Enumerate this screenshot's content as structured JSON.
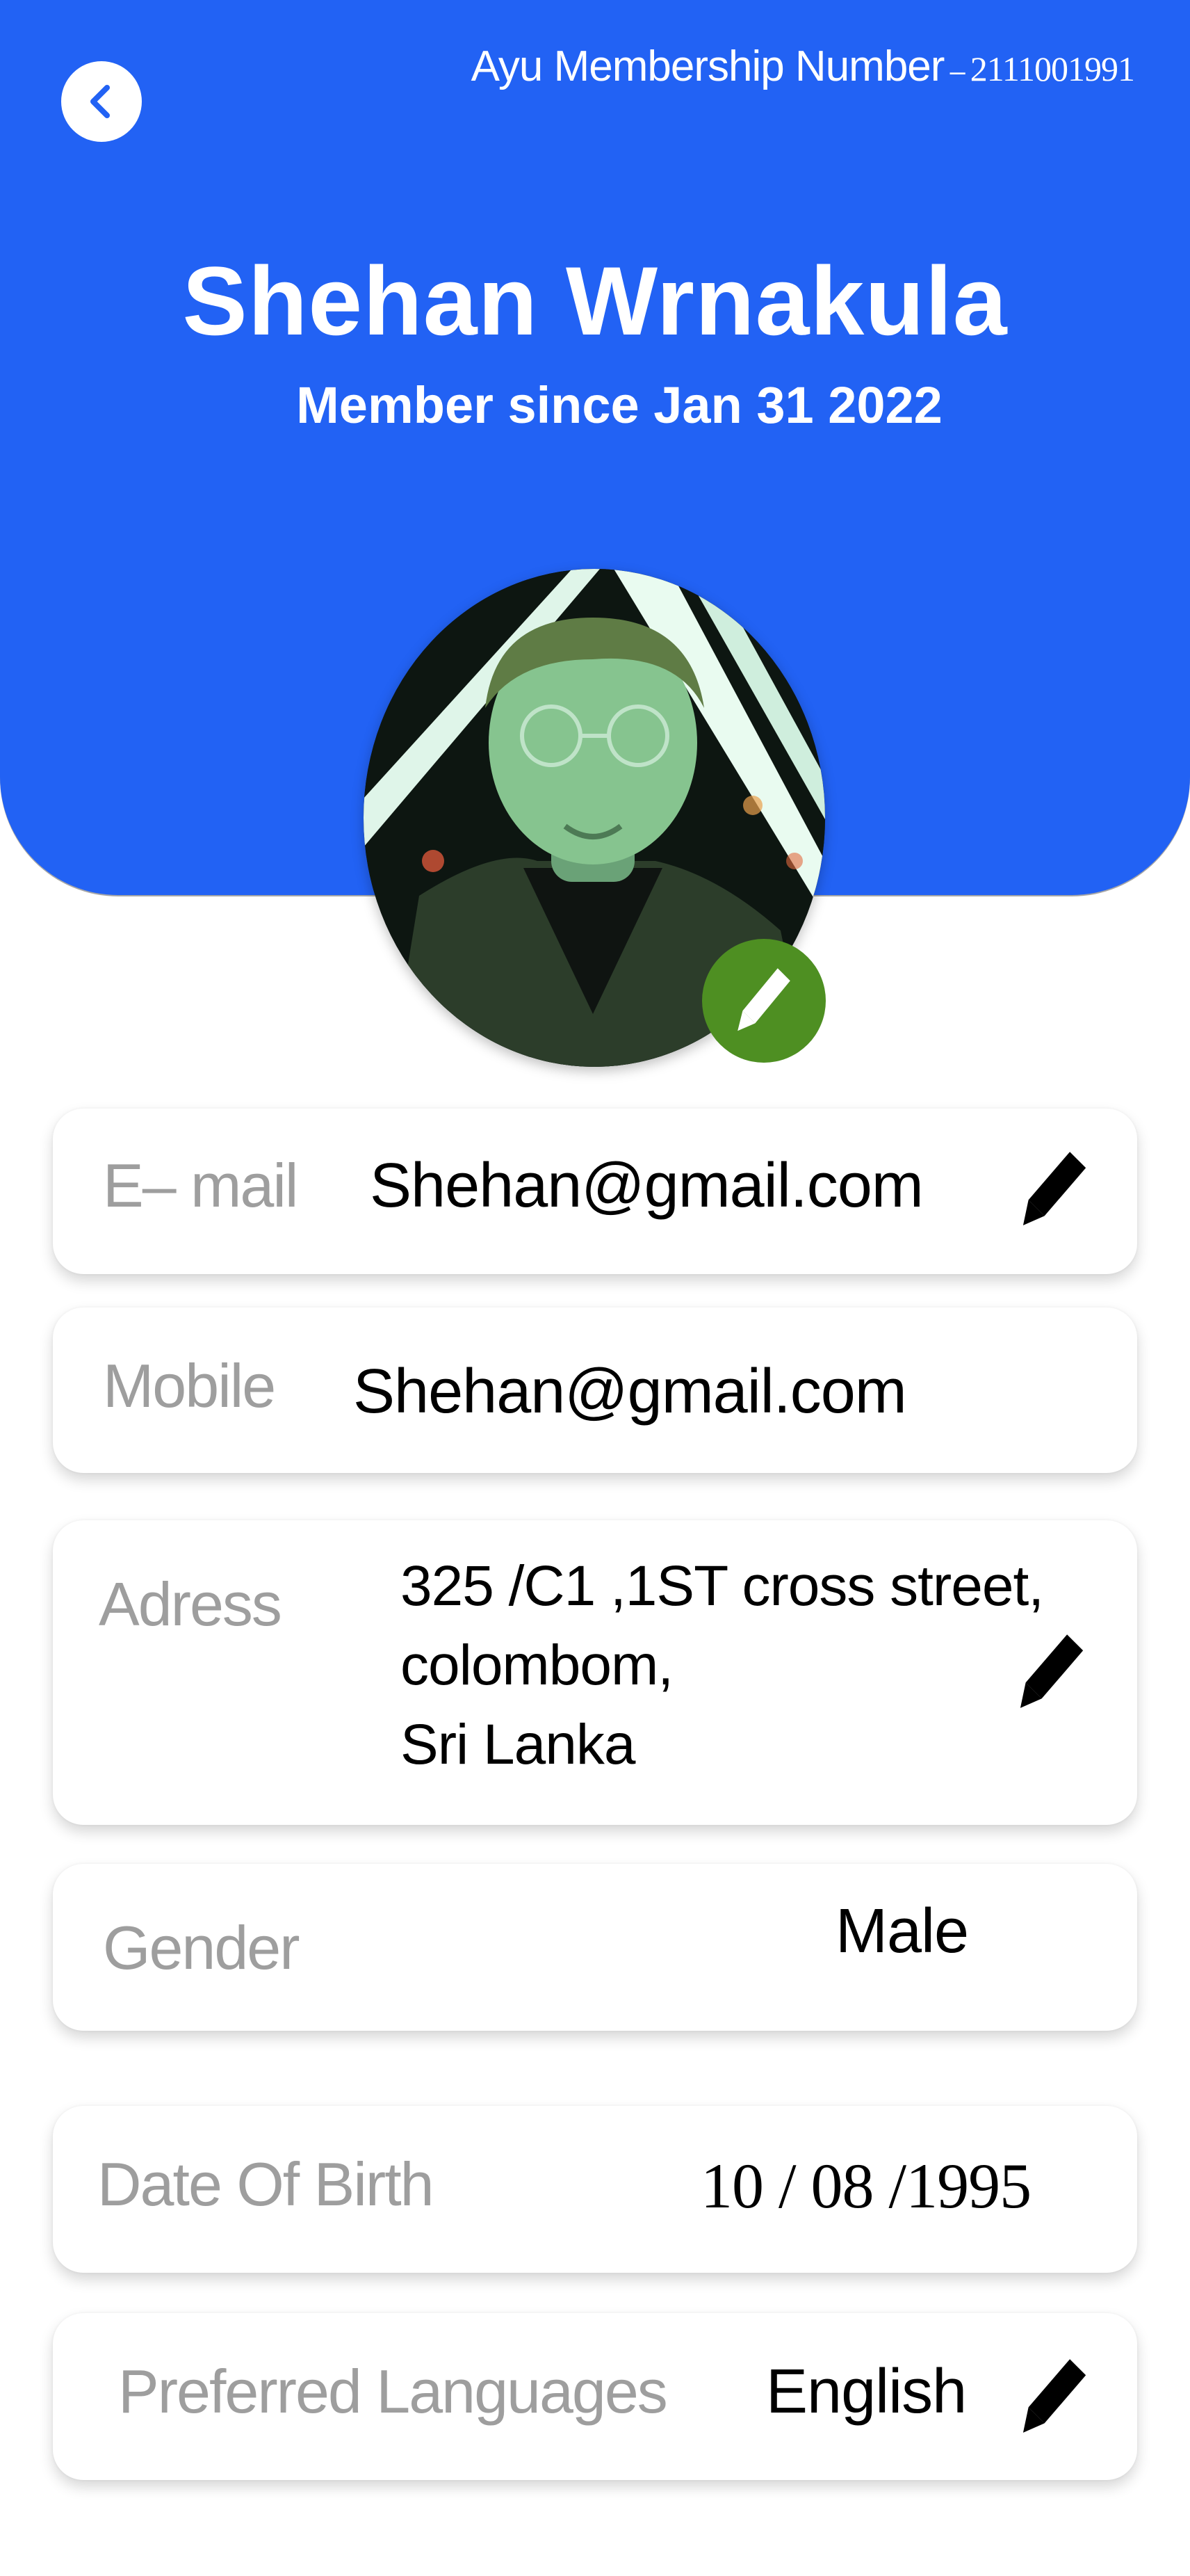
{
  "header": {
    "membership_label": "Ayu Membership Number",
    "membership_separator": "–",
    "membership_number": "2111001991",
    "member_name": "Shehan Wrnakula",
    "member_since": "Member since Jan 31 2022"
  },
  "colors": {
    "header_bg": "#2262f4",
    "edit_photo_bg": "#4e8f22",
    "label_text": "#9e9e9e"
  },
  "icons": {
    "back": "chevron-left-icon",
    "edit_photo": "pencil-icon",
    "edit_field": "pencil-icon"
  },
  "fields": {
    "email": {
      "label": "E– mail",
      "value": "Shehan@gmail.com"
    },
    "mobile": {
      "label": "Mobile",
      "value": "Shehan@gmail.com"
    },
    "address": {
      "label": "Adress",
      "lines": [
        "325 /C1 ,1ST cross street,",
        "colombom,",
        "Sri Lanka"
      ]
    },
    "gender": {
      "label": "Gender",
      "value": "Male"
    },
    "dob": {
      "label": "Date Of Birth",
      "value": "10 / 08 /1995"
    },
    "language": {
      "label": "Preferred Languages",
      "value": "English"
    }
  }
}
